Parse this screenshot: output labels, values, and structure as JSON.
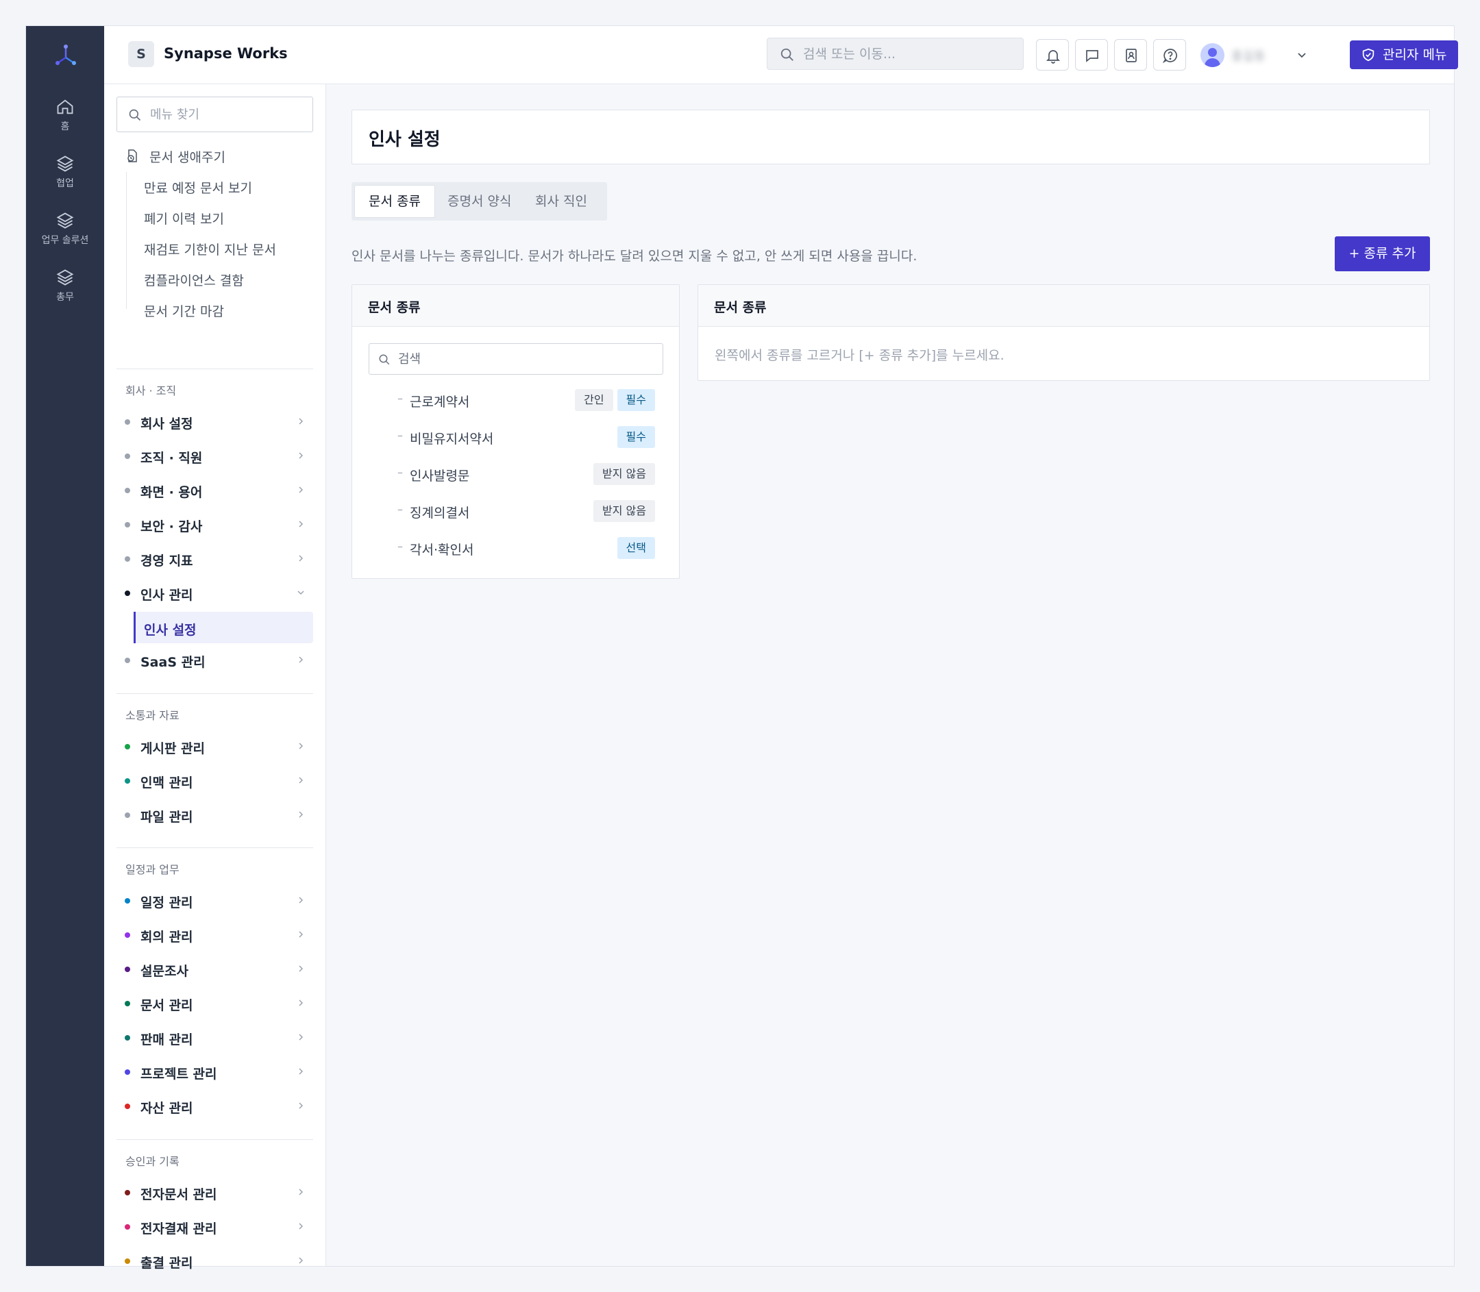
{
  "rail": {
    "items": [
      {
        "label": "홈",
        "icon": "home-icon"
      },
      {
        "label": "협업",
        "icon": "layers-icon"
      },
      {
        "label": "업무 솔루션",
        "icon": "layers-icon"
      },
      {
        "label": "총무",
        "icon": "layers-icon"
      }
    ]
  },
  "header": {
    "workspace_initial": "S",
    "workspace_name": "Synapse Works",
    "search_placeholder": "검색 또는 이동...",
    "user_name": "홍길동",
    "admin_button": "관리자 메뉴"
  },
  "sidebar": {
    "search_placeholder": "메뉴 찾기",
    "lifecycle": {
      "title": "문서 생애주기",
      "items": [
        "만료 예정 문서 보기",
        "폐기 이력 보기",
        "재검토 기한이 지난 문서",
        "컴플라이언스 결함",
        "문서 기간 마감"
      ]
    },
    "sections": [
      {
        "title": "회사 · 조직",
        "items": [
          {
            "label": "회사 설정",
            "dot": "#9ca3af"
          },
          {
            "label": "조직 · 직원",
            "dot": "#9ca3af"
          },
          {
            "label": "화면 · 용어",
            "dot": "#9ca3af"
          },
          {
            "label": "보안 · 감사",
            "dot": "#9ca3af"
          },
          {
            "label": "경영 지표",
            "dot": "#9ca3af"
          },
          {
            "label": "인사 관리",
            "dot": "#111827"
          },
          {
            "label": "SaaS 관리",
            "dot": "#9ca3af"
          }
        ],
        "active_sub": "인사 설정"
      },
      {
        "title": "소통과 자료",
        "items": [
          {
            "label": "게시판 관리",
            "dot": "#16a34a"
          },
          {
            "label": "인맥 관리",
            "dot": "#0d9488"
          },
          {
            "label": "파일 관리",
            "dot": "#9ca3af"
          }
        ]
      },
      {
        "title": "일정과 업무",
        "items": [
          {
            "label": "일정 관리",
            "dot": "#0284c7"
          },
          {
            "label": "회의 관리",
            "dot": "#9333ea"
          },
          {
            "label": "설문조사",
            "dot": "#581c87"
          },
          {
            "label": "문서 관리",
            "dot": "#047857"
          },
          {
            "label": "판매 관리",
            "dot": "#0f766e"
          },
          {
            "label": "프로젝트 관리",
            "dot": "#4f46e5"
          },
          {
            "label": "자산 관리",
            "dot": "#dc2626"
          }
        ]
      },
      {
        "title": "승인과 기록",
        "items": [
          {
            "label": "전자문서 관리",
            "dot": "#7f1d1d"
          },
          {
            "label": "전자결재 관리",
            "dot": "#db2777"
          },
          {
            "label": "출결 관리",
            "dot": "#ca8a04"
          }
        ]
      }
    ]
  },
  "main": {
    "title": "인사 설정",
    "tabs": [
      "문서 종류",
      "증명서 양식",
      "회사 직인"
    ],
    "description": "인사 문서를 나누는 종류입니다. 문서가 하나라도 달려 있으면 지울 수 없고, 안 쓰게 되면 사용을 끕니다.",
    "add_button": "+ 종류 추가",
    "left_panel": {
      "title": "문서 종류",
      "search_placeholder": "검색",
      "items": [
        {
          "name": "근로계약서",
          "badges": [
            {
              "text": "간인",
              "style": "gray"
            },
            {
              "text": "필수",
              "style": "blue"
            }
          ]
        },
        {
          "name": "비밀유지서약서",
          "badges": [
            {
              "text": "필수",
              "style": "blue"
            }
          ]
        },
        {
          "name": "인사발령문",
          "badges": [
            {
              "text": "받지 않음",
              "style": "gray"
            }
          ]
        },
        {
          "name": "징계의결서",
          "badges": [
            {
              "text": "받지 않음",
              "style": "gray"
            }
          ]
        },
        {
          "name": "각서·확인서",
          "badges": [
            {
              "text": "선택",
              "style": "blue"
            }
          ]
        }
      ]
    },
    "right_panel": {
      "title": "문서 종류",
      "empty_message": "왼쪽에서 종류를 고르거나 [+ 종류 추가]를 누르세요."
    }
  }
}
